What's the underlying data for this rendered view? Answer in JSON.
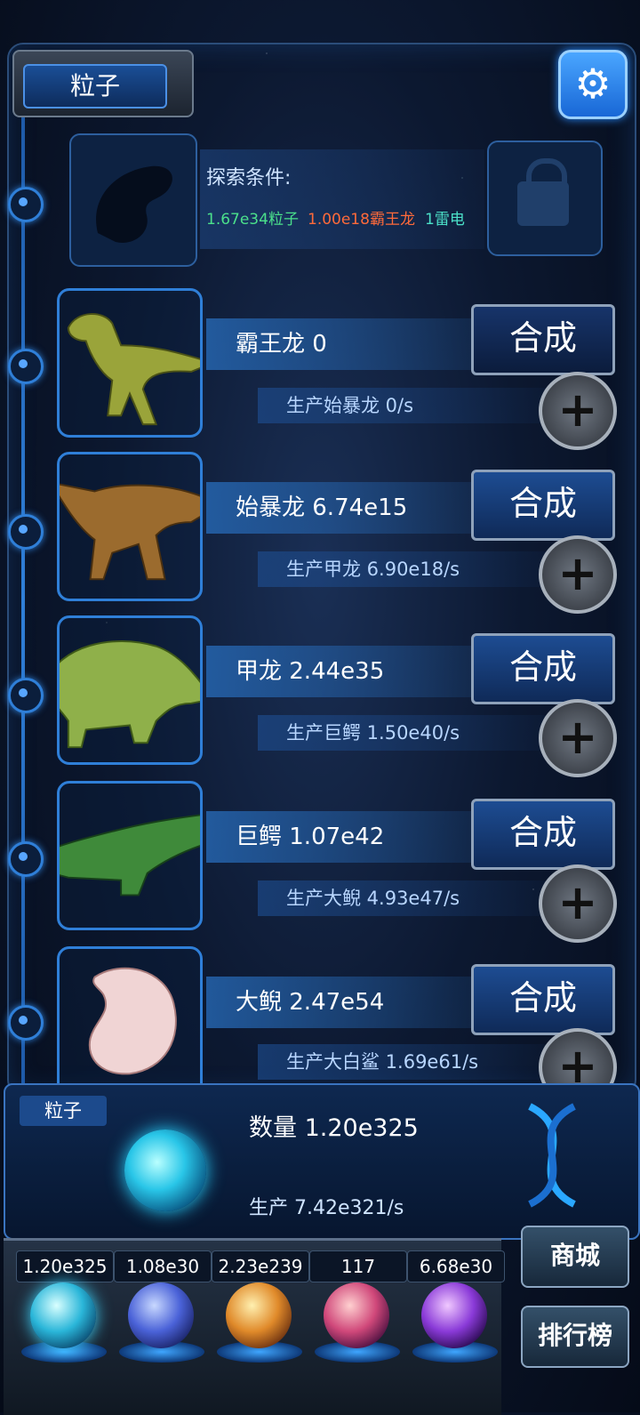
{
  "header": {
    "title": "粒子"
  },
  "explore": {
    "label": "探索条件:",
    "requirements": [
      {
        "text": "1.67e34粒子",
        "color": "#4be08b"
      },
      {
        "text": "1.00e18霸王龙",
        "color": "#ff6a3a"
      },
      {
        "text": "1雷电",
        "color": "#4be0c8"
      }
    ]
  },
  "creatures": [
    {
      "name": "霸王龙 0",
      "production": "生产始暴龙 0/s",
      "button": "合成"
    },
    {
      "name": "始暴龙 6.74e15",
      "production": "生产甲龙 6.90e18/s",
      "button": "合成"
    },
    {
      "name": "甲龙 2.44e35",
      "production": "生产巨鳄 1.50e40/s",
      "button": "合成"
    },
    {
      "name": "巨鳄 1.07e42",
      "production": "生产大鲵 4.93e47/s",
      "button": "合成"
    },
    {
      "name": "大鲵 2.47e54",
      "production": "生产大白鲨 1.69e61/s",
      "button": "合成"
    }
  ],
  "bottom": {
    "tab": "粒子",
    "count": "数量 1.20e325",
    "production": "生产 7.42e321/s"
  },
  "resources": [
    "1.20e325",
    "1.08e30",
    "2.23e239",
    "117",
    "6.68e30"
  ],
  "side_buttons": {
    "shop": "商城",
    "rank": "排行榜"
  }
}
